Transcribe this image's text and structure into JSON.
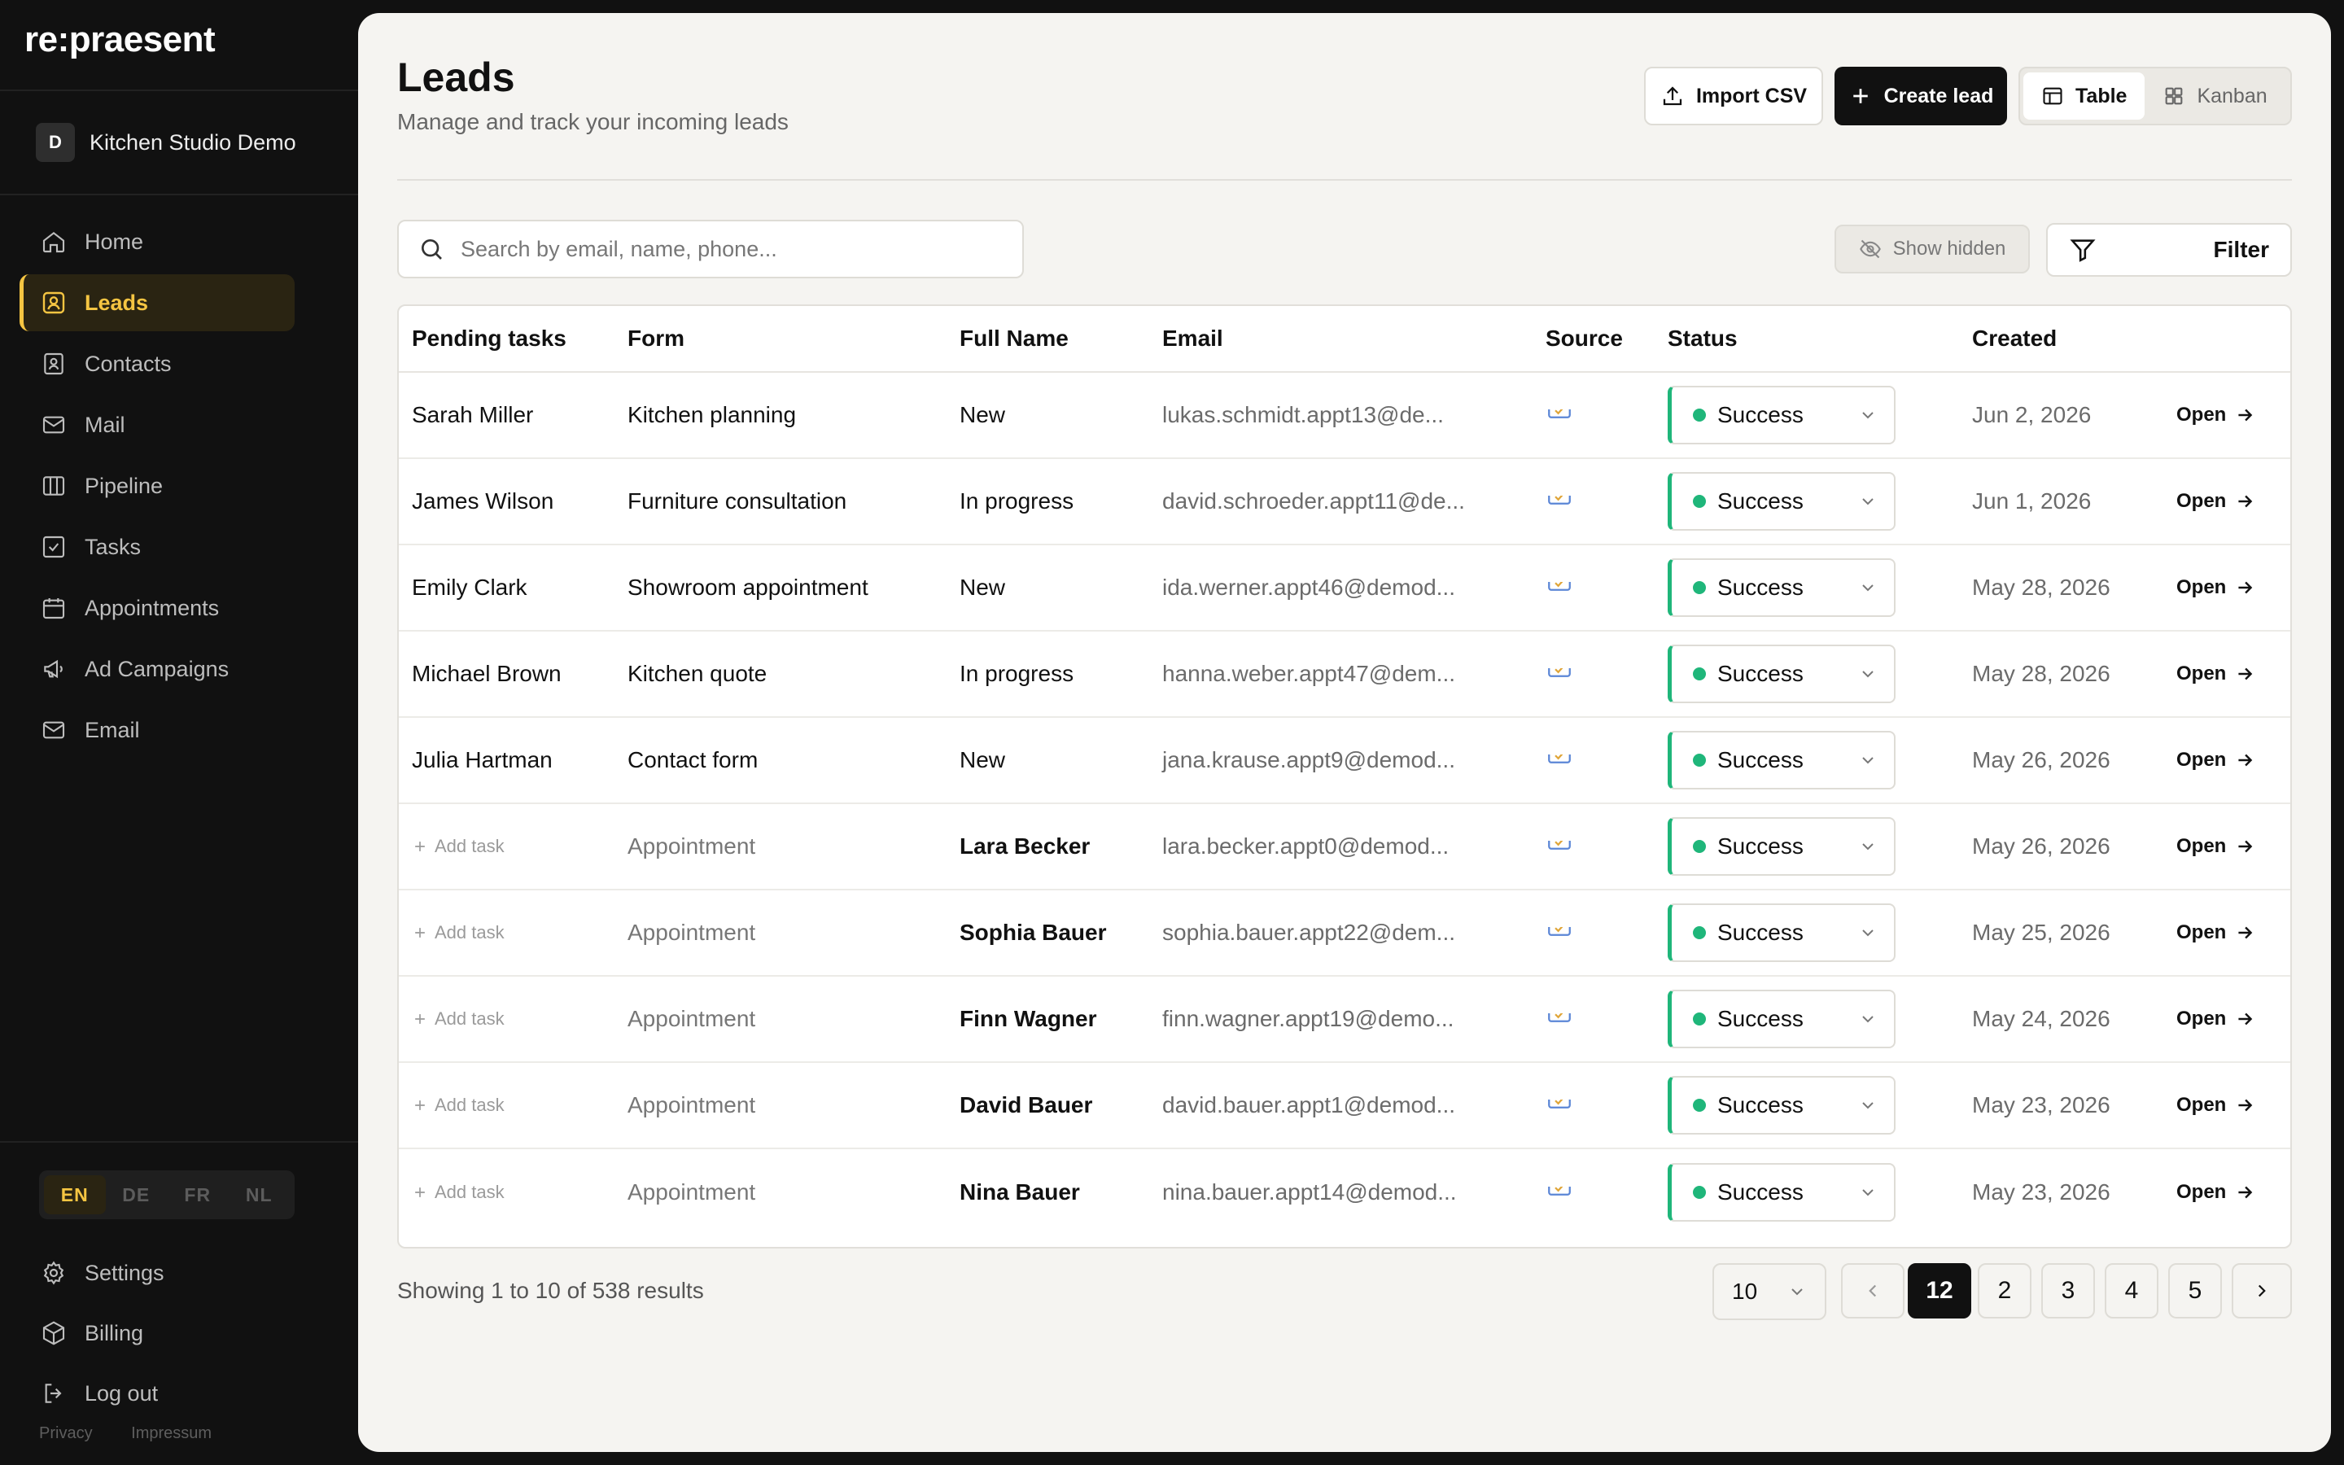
{
  "brand": "re:praesent",
  "workspace": {
    "initial": "D",
    "name": "Kitchen Studio Demo"
  },
  "nav": [
    {
      "label": "Home",
      "icon": "home-icon"
    },
    {
      "label": "Leads",
      "icon": "leads-icon",
      "active": true
    },
    {
      "label": "Contacts",
      "icon": "contacts-icon"
    },
    {
      "label": "Mail",
      "icon": "mail-icon"
    },
    {
      "label": "Pipeline",
      "icon": "pipeline-icon"
    },
    {
      "label": "Tasks",
      "icon": "tasks-icon"
    },
    {
      "label": "Appointments",
      "icon": "calendar-icon"
    },
    {
      "label": "Ad Campaigns",
      "icon": "megaphone-icon"
    },
    {
      "label": "Email",
      "icon": "email-icon"
    }
  ],
  "languages": [
    "EN",
    "DE",
    "FR",
    "NL"
  ],
  "active_language": "EN",
  "bottom_nav": [
    {
      "label": "Settings",
      "icon": "gear-icon"
    },
    {
      "label": "Billing",
      "icon": "box-icon"
    },
    {
      "label": "Log out",
      "icon": "logout-icon"
    }
  ],
  "legal": {
    "privacy": "Privacy",
    "impressum": "Impressum"
  },
  "header": {
    "title": "Leads",
    "subtitle": "Manage and track your incoming leads",
    "import_label": "Import CSV",
    "create_label": "Create lead",
    "view_table": "Table",
    "view_kanban": "Kanban",
    "active_view": "Table"
  },
  "toolbar": {
    "search_placeholder": "Search by email, name, phone...",
    "search_value": "",
    "show_hidden": "Show hidden",
    "filter": "Filter"
  },
  "table": {
    "columns": {
      "pending_tasks": "Pending tasks",
      "form": "Form",
      "full_name": "Full Name",
      "email": "Email",
      "source": "Source",
      "status": "Status",
      "created": "Created"
    },
    "add_task_label": "Add task",
    "open_label": "Open",
    "rows": [
      {
        "task": "Sarah Miller",
        "form": "Kitchen planning",
        "name": "New",
        "email": "lukas.schmidt.appt13@de...",
        "status": "Success",
        "created": "Jun 2, 2026"
      },
      {
        "task": "James Wilson",
        "form": "Furniture consultation",
        "name": "In progress",
        "email": "david.schroeder.appt11@de...",
        "status": "Success",
        "created": "Jun 1, 2026"
      },
      {
        "task": "Emily Clark",
        "form": "Showroom appointment",
        "name": "New",
        "email": "ida.werner.appt46@demod...",
        "status": "Success",
        "created": "May 28, 2026"
      },
      {
        "task": "Michael Brown",
        "form": "Kitchen quote",
        "name": "In progress",
        "email": "hanna.weber.appt47@dem...",
        "status": "Success",
        "created": "May 28, 2026"
      },
      {
        "task": "Julia Hartman",
        "form": "Contact form",
        "name": "New",
        "email": "jana.krause.appt9@demod...",
        "status": "Success",
        "created": "May 26, 2026"
      },
      {
        "task": "",
        "form": "Appointment",
        "name": "Lara Becker",
        "email": "lara.becker.appt0@demod...",
        "status": "Success",
        "created": "May 26, 2026"
      },
      {
        "task": "",
        "form": "Appointment",
        "name": "Sophia Bauer",
        "email": "sophia.bauer.appt22@dem...",
        "status": "Success",
        "created": "May 25, 2026"
      },
      {
        "task": "",
        "form": "Appointment",
        "name": "Finn Wagner",
        "email": "finn.wagner.appt19@demo...",
        "status": "Success",
        "created": "May 24, 2026"
      },
      {
        "task": "",
        "form": "Appointment",
        "name": "David Bauer",
        "email": "david.bauer.appt1@demod...",
        "status": "Success",
        "created": "May 23, 2026"
      },
      {
        "task": "",
        "form": "Appointment",
        "name": "Nina Bauer",
        "email": "nina.bauer.appt14@demod...",
        "status": "Success",
        "created": "May 23, 2026"
      }
    ]
  },
  "pagination": {
    "showing": "Showing 1 to 10 of 538 results",
    "per_page": "10",
    "pages": [
      "12",
      "2",
      "3",
      "4",
      "5"
    ],
    "current": "12"
  },
  "colors": {
    "accent": "#f5c542",
    "success": "#1fb67a",
    "sidebar_bg": "#111111",
    "panel_bg": "#f5f4f1"
  }
}
